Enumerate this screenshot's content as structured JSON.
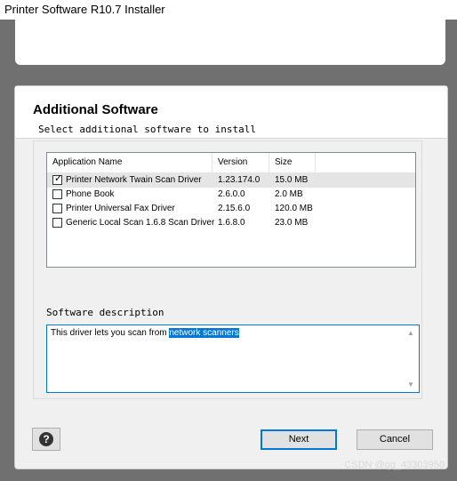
{
  "window": {
    "title": "Printer Software R10.7 Installer"
  },
  "header": {
    "title": "Additional Software",
    "subtitle": "Select additional software to install"
  },
  "table": {
    "columns": [
      "Application Name",
      "Version",
      "Size"
    ],
    "rows": [
      {
        "name": "Printer Network Twain Scan Driver",
        "version": "1.23.174.0",
        "size": "15.0 MB",
        "checked": true,
        "check_glyph": "✓"
      },
      {
        "name": "Phone Book",
        "version": "2.6.0.0",
        "size": "2.0 MB",
        "checked": false
      },
      {
        "name": "Printer Universal Fax Driver",
        "version": "2.15.6.0",
        "size": "120.0 MB",
        "checked": false
      },
      {
        "name": "Generic Local Scan 1.6.8 Scan Driver",
        "version": "1.6.8.0",
        "size": "23.0 MB",
        "checked": false
      }
    ]
  },
  "description": {
    "label": "Software description",
    "text_before": "This driver lets you scan from ",
    "text_highlight": "network scanners"
  },
  "buttons": {
    "help_glyph": "?",
    "next": "Next",
    "cancel": "Cancel"
  },
  "watermark": "CSDN @qq_43303950",
  "colors": {
    "accent": "#0078d7",
    "selected_row": "#e5e5e5"
  },
  "icons": {
    "help": "help-icon",
    "scroll_up": "scroll-up-icon",
    "scroll_down": "scroll-down-icon"
  }
}
